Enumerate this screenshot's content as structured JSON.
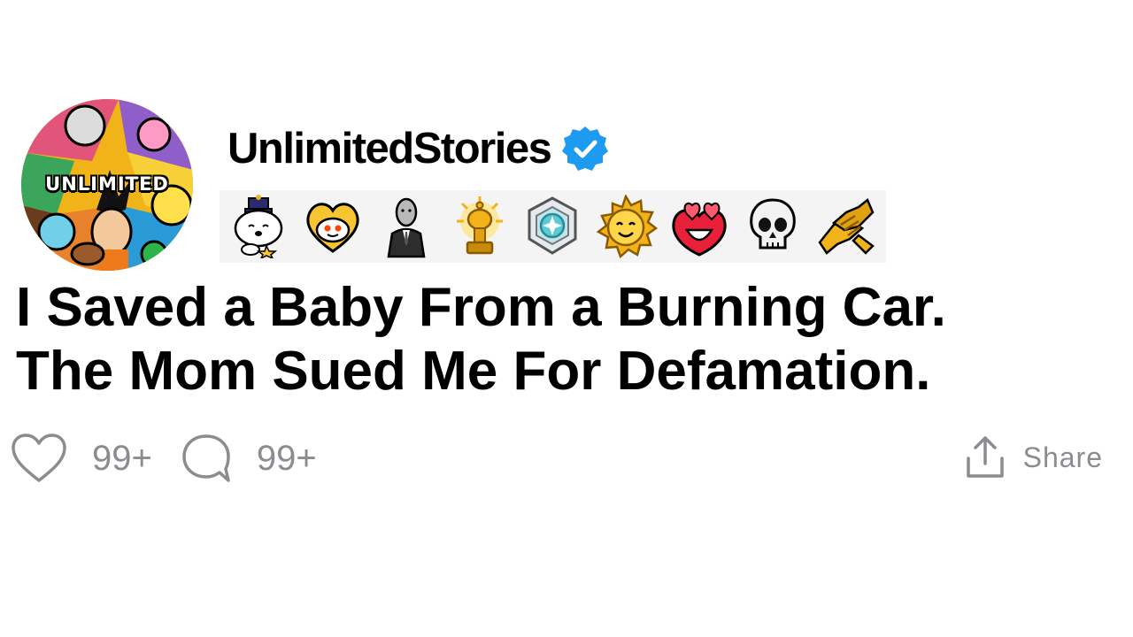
{
  "post": {
    "avatar_text": "UNLIMITED",
    "username": "UnlimitedStories",
    "verified_icon": "verified-badge-icon",
    "awards": [
      "wholesome-seal-award-icon",
      "wholesome-heart-award-icon",
      "stonks-businessman-award-icon",
      "gold-award-icon",
      "platinum-award-icon",
      "helpful-sun-award-icon",
      "heartwarming-award-icon",
      "skull-award-icon",
      "bro-handshake-award-icon"
    ],
    "title_line_1": "I Saved a Baby From a Burning Car.",
    "title_line_2": "The Mom Sued Me For Defamation.",
    "like_count": "99+",
    "comment_count": "99+",
    "share_label": "Share"
  },
  "colors": {
    "verified": "#1d9bf0",
    "muted": "#8a8c90",
    "award_bg": "#f4f4f4"
  }
}
